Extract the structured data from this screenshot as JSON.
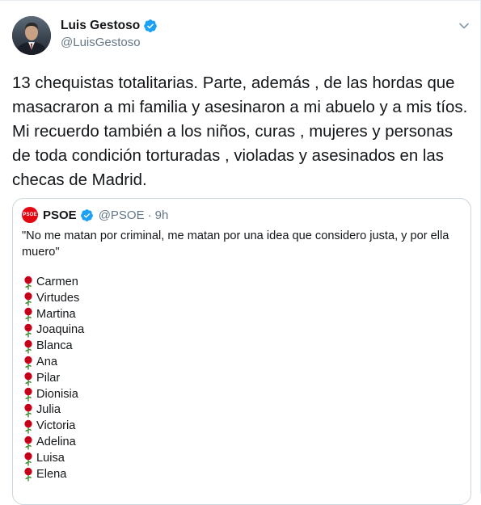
{
  "author": {
    "display_name": "Luis Gestoso",
    "handle": "@LuisGestoso",
    "verified": true
  },
  "tweet": {
    "text": "13 chequistas totalitarias. Parte, además , de las hordas que masacraron a mi familia y asesinaron a mi abuelo y a mis tíos. Mi recuerdo también a los niños, curas , mujeres y personas de toda condición torturadas , violadas y asesinados en las checas de Madrid."
  },
  "quoted": {
    "avatar_text": "PSOE",
    "display_name": "PSOE",
    "handle": "@PSOE",
    "separator": "·",
    "time": "9h",
    "quote": "\"No me matan por criminal, me matan por una idea que considero justa, y por ella muero\"",
    "names": [
      "Carmen",
      "Virtudes",
      "Martina",
      "Joaquina",
      "Blanca",
      "Ana",
      "Pilar",
      "Dionisia",
      "Julia",
      "Victoria",
      "Adelina",
      "Luisa",
      "Elena"
    ],
    "list_icon": "rose-icon"
  },
  "colors": {
    "verified": "#1da1f2",
    "secondary_text": "#657786",
    "psoe_red": "#e30613",
    "rose_red": "#d0021b",
    "border": "#ccd6dd"
  }
}
